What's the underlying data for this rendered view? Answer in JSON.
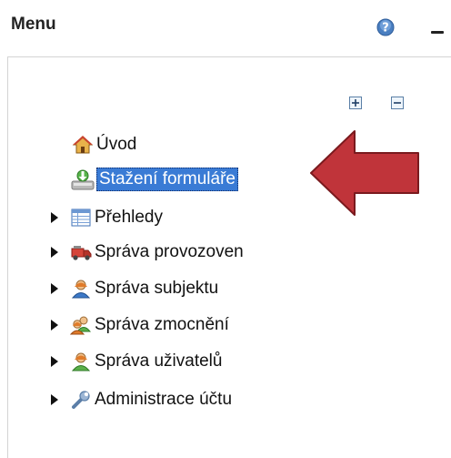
{
  "header": {
    "title": "Menu",
    "help_icon": "help-icon",
    "minimize_icon": "minimize-icon"
  },
  "toolbar": {
    "expand_all_icon": "expand-all-icon",
    "collapse_all_icon": "collapse-all-icon"
  },
  "tree": {
    "items": [
      {
        "label": "Úvod",
        "icon": "home-icon",
        "expandable": false,
        "selected": false
      },
      {
        "label": "Stažení formuláře",
        "icon": "download-form-icon",
        "expandable": false,
        "selected": true
      },
      {
        "label": "Přehledy",
        "icon": "table-icon",
        "expandable": true,
        "selected": false
      },
      {
        "label": "Správa provozoven",
        "icon": "truck-icon",
        "expandable": true,
        "selected": false
      },
      {
        "label": "Správa subjektu",
        "icon": "user-icon",
        "expandable": true,
        "selected": false
      },
      {
        "label": "Správa zmocnění",
        "icon": "users-icon",
        "expandable": true,
        "selected": false
      },
      {
        "label": "Správa uživatelů",
        "icon": "user-green-icon",
        "expandable": true,
        "selected": false
      },
      {
        "label": "Administrace účtu",
        "icon": "wrench-icon",
        "expandable": true,
        "selected": false
      }
    ]
  },
  "colors": {
    "selection": "#3a7bd5",
    "annotation_arrow": "#c0343a"
  }
}
